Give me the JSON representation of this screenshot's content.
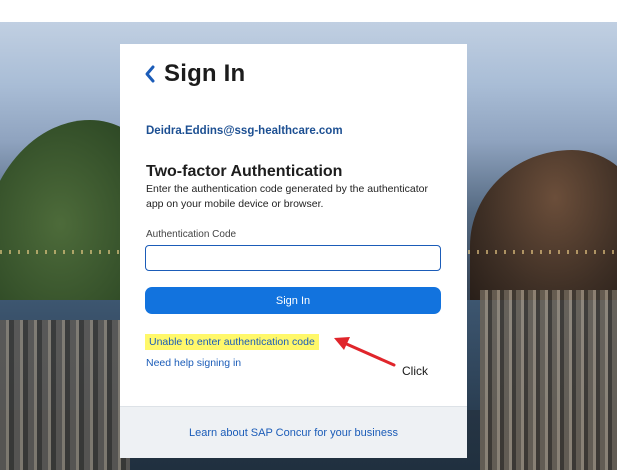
{
  "page": {
    "title": "Sign In",
    "email": "Deidra.Eddins@ssg-healthcare.com",
    "heading": "Two-factor Authentication",
    "description": "Enter the authentication code generated by the authenticator app on your mobile device or browser.",
    "code_label": "Authentication Code",
    "code_value": "",
    "signin_label": "Sign In",
    "unable_link": "Unable to enter authentication code",
    "help_link": "Need help signing in",
    "footer_link": "Learn about SAP Concur for your business"
  },
  "annotation": {
    "click_label": "Click",
    "arrow_color": "#e0252b",
    "highlight_color": "#fff86a"
  },
  "icons": {
    "back": "chevron-left-icon"
  },
  "colors": {
    "primary_button": "#1273de",
    "link": "#1b5cb8"
  }
}
